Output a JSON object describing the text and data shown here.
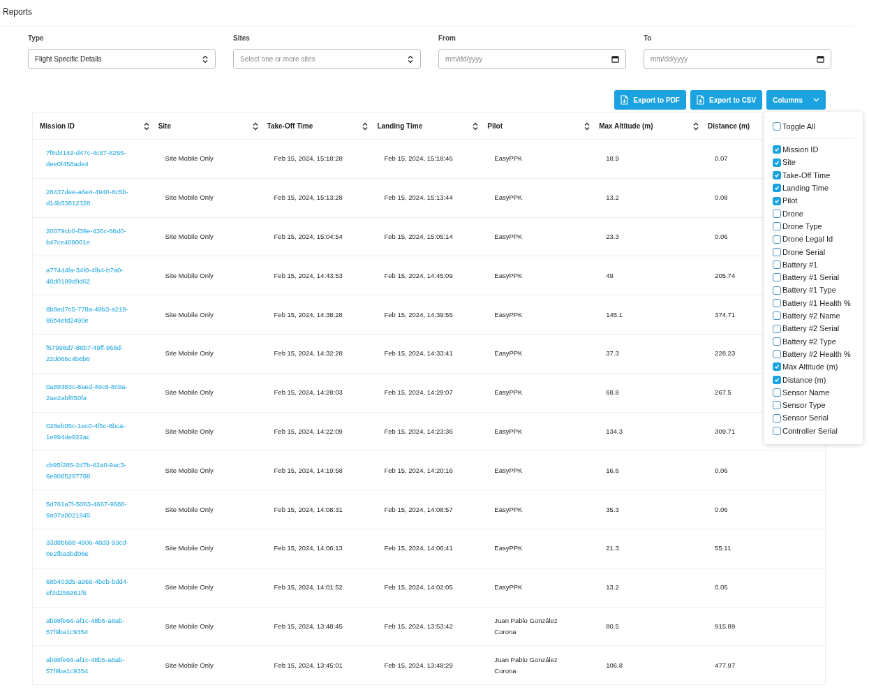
{
  "page_title": "Reports",
  "filters": [
    {
      "label": "Type",
      "kind": "select",
      "value": "Flight Specific Details"
    },
    {
      "label": "Sites",
      "kind": "select",
      "placeholder": "Select one or more sites"
    },
    {
      "label": "From",
      "kind": "date",
      "placeholder": "mm/dd/yyyy"
    },
    {
      "label": "To",
      "kind": "date",
      "placeholder": "mm/dd/yyyy"
    }
  ],
  "actions": [
    {
      "label": "Export to PDF",
      "kind": "file"
    },
    {
      "label": "Export to CSV",
      "kind": "file"
    },
    {
      "label": "Columns",
      "kind": "menu"
    }
  ],
  "table": {
    "columns": [
      {
        "label": "Mission ID",
        "sortable": true
      },
      {
        "label": "Site",
        "sortable": true
      },
      {
        "label": "Take-Off Time",
        "sortable": true
      },
      {
        "label": "Landing Time",
        "sortable": true
      },
      {
        "label": "Pilot",
        "sortable": true
      },
      {
        "label": "Max Altitude (m)",
        "sortable": true
      },
      {
        "label": "Distance (m)",
        "sortable": false
      }
    ],
    "rows": [
      [
        "7f8d4149-d47c-4c87-8255-dee0f458ade4",
        "Site Mobile Only",
        "Feb 15, 2024, 15:18:28",
        "Feb 15, 2024, 15:18:46",
        "EasyPPK",
        "18.9",
        "0.07"
      ],
      [
        "28437dee-a6e4-4940-8c5b-d14b53812328",
        "Site Mobile Only",
        "Feb 15, 2024, 15:13:28",
        "Feb 15, 2024, 15:13:44",
        "EasyPPK",
        "13.2",
        "0.08"
      ],
      [
        "20079cb0-f39e-436c-86d0-b47ce408001e",
        "Site Mobile Only",
        "Feb 15, 2024, 15:04:54",
        "Feb 15, 2024, 15:05:14",
        "EasyPPK",
        "23.3",
        "0.06"
      ],
      [
        "a774d4fa-34f0-4fb4-b7a0-48d0189d9d62",
        "Site Mobile Only",
        "Feb 15, 2024, 14:43:53",
        "Feb 15, 2024, 14:45:09",
        "EasyPPK",
        "49",
        "205.74"
      ],
      [
        "8b8ed7c5-778a-49b3-a219-86b4efd2490e",
        "Site Mobile Only",
        "Feb 15, 2024, 14:38:28",
        "Feb 15, 2024, 14:39:55",
        "EasyPPK",
        "145.1",
        "374.71"
      ],
      [
        "f57998d7-88b7-49ff-968d-22d066c4b6b6",
        "Site Mobile Only",
        "Feb 15, 2024, 14:32:28",
        "Feb 15, 2024, 14:33:41",
        "EasyPPK",
        "37.3",
        "228.23"
      ],
      [
        "0a89383c-8aed-49c8-8c9a-2ae2abf650fa",
        "Site Mobile Only",
        "Feb 15, 2024, 14:28:03",
        "Feb 15, 2024, 14:29:07",
        "EasyPPK",
        "68.8",
        "267.5"
      ],
      [
        "028eb05c-1ec0-4f5c-8bca-1e994de922ac",
        "Site Mobile Only",
        "Feb 15, 2024, 14:22:09",
        "Feb 15, 2024, 14:23:36",
        "EasyPPK",
        "134.3",
        "309.71"
      ],
      [
        "cb95f285-2d7b-42a0-9ac3-6e9085297788",
        "Site Mobile Only",
        "Feb 15, 2024, 14:19:58",
        "Feb 15, 2024, 14:20:16",
        "EasyPPK",
        "16.6",
        "0.06"
      ],
      [
        "5d761a7f-5063-4667-9686-9a97a0021945",
        "Site Mobile Only",
        "Feb 15, 2024, 14:08:31",
        "Feb 15, 2024, 14:08:57",
        "EasyPPK",
        "35.3",
        "0.06"
      ],
      [
        "33d8b688-4906-48d3-93cd-0e2fba3bd08e",
        "Site Mobile Only",
        "Feb 15, 2024, 14:06:13",
        "Feb 15, 2024, 14:06:41",
        "EasyPPK",
        "21.3",
        "55.11"
      ],
      [
        "68b403d5-a966-4beb-bdd4-ef3d256961f6",
        "Site Mobile Only",
        "Feb 15, 2024, 14:01:52",
        "Feb 15, 2024, 14:02:05",
        "EasyPPK",
        "13.2",
        "0.05"
      ],
      [
        "ab98fe66-af1c-48b5-a8ab-57f9ba1c9354",
        "Site Mobile Only",
        "Feb 15, 2024, 13:48:45",
        "Feb 15, 2024, 13:53:42",
        "Juan Pablo González Corona",
        "80.5",
        "915.89"
      ],
      [
        "ab98fe66-af1c-48b5-a8ab-57f9ba1c9354",
        "Site Mobile Only",
        "Feb 15, 2024, 13:45:01",
        "Feb 15, 2024, 13:48:29",
        "Juan Pablo González Corona",
        "106.8",
        "477.97"
      ]
    ]
  },
  "columns_menu": {
    "toggle_all": {
      "label": "Toggle All",
      "checked": false
    },
    "items": [
      {
        "label": "Mission ID",
        "checked": true
      },
      {
        "label": "Site",
        "checked": true
      },
      {
        "label": "Take-Off Time",
        "checked": true
      },
      {
        "label": "Landing Time",
        "checked": true
      },
      {
        "label": "Pilot",
        "checked": true
      },
      {
        "label": "Drone",
        "checked": false
      },
      {
        "label": "Drone Type",
        "checked": false
      },
      {
        "label": "Drone Legal Id",
        "checked": false
      },
      {
        "label": "Drone Serial",
        "checked": false
      },
      {
        "label": "Battery #1",
        "checked": false
      },
      {
        "label": "Battery #1 Serial",
        "checked": false
      },
      {
        "label": "Battery #1 Type",
        "checked": false
      },
      {
        "label": "Battery #1 Health %",
        "checked": false
      },
      {
        "label": "Battery #2 Name",
        "checked": false
      },
      {
        "label": "Battery #2 Serial",
        "checked": false
      },
      {
        "label": "Battery #2 Type",
        "checked": false
      },
      {
        "label": "Battery #2 Health %",
        "checked": false
      },
      {
        "label": "Max Altitude (m)",
        "checked": true
      },
      {
        "label": "Distance (m)",
        "checked": true
      },
      {
        "label": "Sensor Name",
        "checked": false
      },
      {
        "label": "Sensor Type",
        "checked": false
      },
      {
        "label": "Sensor Serial",
        "checked": false
      },
      {
        "label": "Controller Serial",
        "checked": false
      }
    ]
  }
}
